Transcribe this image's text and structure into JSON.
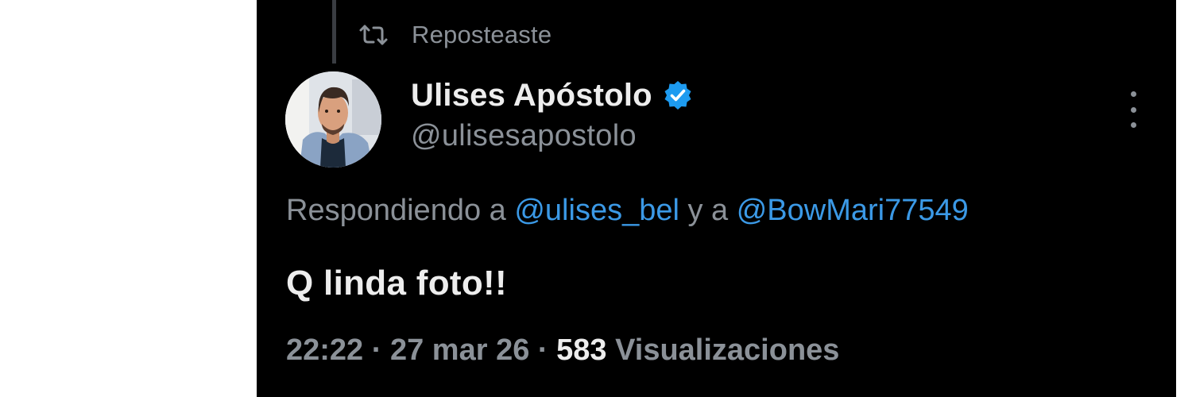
{
  "repost": {
    "label": "Reposteaste",
    "icon": "repost-icon"
  },
  "author": {
    "display_name": "Ulises Apóstolo",
    "handle": "@ulisesapostolo",
    "verified_icon": "verified-badge-icon",
    "avatar": "avatar-photo"
  },
  "more_icon": "more-vertical-icon",
  "reply": {
    "prefix": "Respondiendo a ",
    "mention_1": "@ulises_bel",
    "connector": " y a ",
    "mention_2": "@BowMari77549"
  },
  "tweet": {
    "text": "Q linda foto!!"
  },
  "meta": {
    "time": "22:22",
    "separator_1": " · ",
    "date": "27 mar 26",
    "separator_2": " · ",
    "views_count": "583",
    "views_label": " Visualizaciones"
  },
  "colors": {
    "background": "#000000",
    "primary_text": "#ededed",
    "secondary_text": "#8b9198",
    "link": "#3b99e6",
    "verified": "#1d9bf0"
  }
}
